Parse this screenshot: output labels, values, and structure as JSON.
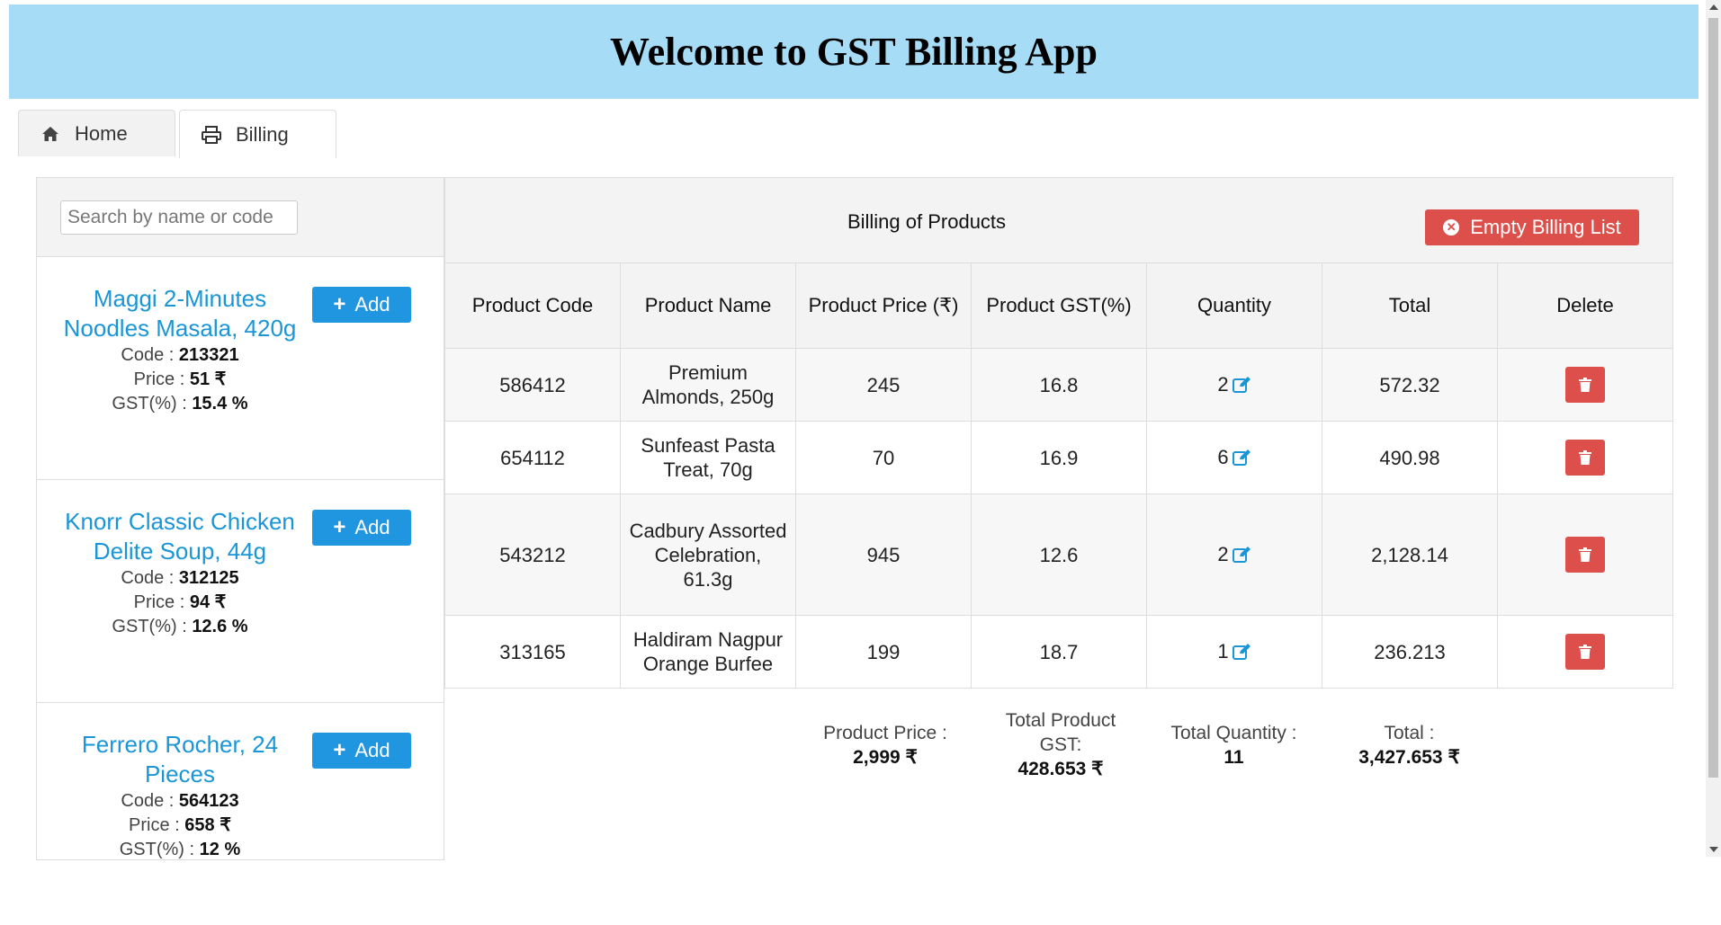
{
  "app": {
    "title": "Welcome to GST Billing App"
  },
  "tabs": [
    {
      "label": "Home",
      "icon": "home-icon"
    },
    {
      "label": "Billing",
      "icon": "printer-icon"
    }
  ],
  "search": {
    "placeholder": "Search by name or code"
  },
  "product_list": {
    "add_label": "Add",
    "code_label": "Code : ",
    "price_label": "Price : ",
    "gst_label": "GST(%) : ",
    "items": [
      {
        "name": "Maggi 2-Minutes Noodles Masala, 420g",
        "code": "213321",
        "price": "51 ₹",
        "gst": "15.4 %"
      },
      {
        "name": "Knorr Classic Chicken Delite Soup, 44g",
        "code": "312125",
        "price": "94 ₹",
        "gst": "12.6 %"
      },
      {
        "name": "Ferrero Rocher, 24 Pieces",
        "code": "564123",
        "price": "658 ₹",
        "gst": "12 %"
      }
    ]
  },
  "billing": {
    "title": "Billing of Products",
    "empty_button": "Empty Billing List",
    "columns": [
      "Product Code",
      "Product Name",
      "Product Price (₹)",
      "Product GST(%)",
      "Quantity",
      "Total",
      "Delete"
    ],
    "rows": [
      {
        "code": "586412",
        "name": "Premium Almonds, 250g",
        "price": "245",
        "gst": "16.8",
        "qty": "2",
        "total": "572.32"
      },
      {
        "code": "654112",
        "name": "Sunfeast Pasta Treat, 70g",
        "price": "70",
        "gst": "16.9",
        "qty": "6",
        "total": "490.98"
      },
      {
        "code": "543212",
        "name": "Cadbury Assorted Celebration, 61.3g",
        "price": "945",
        "gst": "12.6",
        "qty": "2",
        "total": "2,128.14"
      },
      {
        "code": "313165",
        "name": "Haldiram Nagpur Orange Burfee",
        "price": "199",
        "gst": "18.7",
        "qty": "1",
        "total": "236.213"
      }
    ],
    "totals": {
      "price_label": "Product Price :",
      "price_value": "2,999 ₹",
      "gst_label": "Total Product GST:",
      "gst_value": "428.653 ₹",
      "qty_label": "Total Quantity :",
      "qty_value": "11",
      "total_label": "Total :",
      "total_value": "3,427.653 ₹"
    }
  },
  "colors": {
    "header_bg": "#a7dcf6",
    "accent_blue": "#2196e0",
    "danger_red": "#dc4f4a",
    "link_blue": "#1a96d6"
  }
}
